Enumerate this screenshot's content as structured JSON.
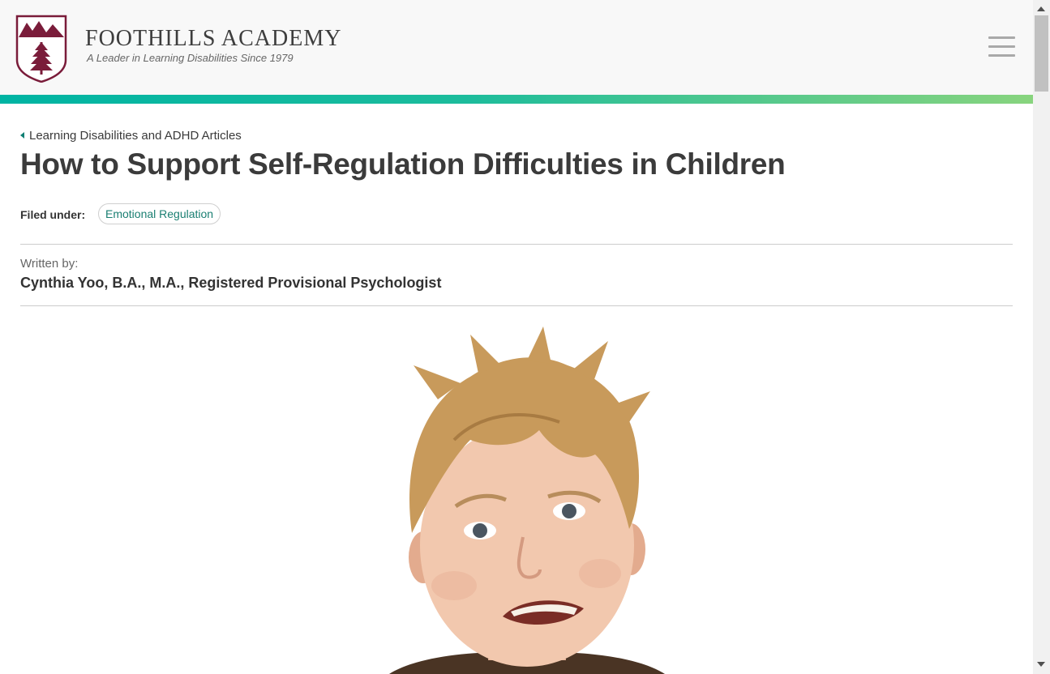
{
  "site": {
    "name": "FOOTHILLS ACADEMY",
    "tagline": "A Leader in Learning Disabilities Since 1979",
    "brand_color": "#7a1c3a",
    "accent_gradient": [
      "#00b4a3",
      "#88d47e"
    ]
  },
  "nav": {
    "menu_icon": "hamburger-menu-icon"
  },
  "article": {
    "breadcrumb": "Learning Disabilities and ADHD Articles",
    "title": "How to Support Self-Regulation Difficulties in Children",
    "filed_under_label": "Filed under:",
    "tags": [
      "Emotional Regulation"
    ],
    "written_by_label": "Written by:",
    "author": "Cynthia Yoo, B.A., M.A., Registered Provisional Psychologist",
    "hero_image": "photo of a young blond boy grimacing"
  }
}
